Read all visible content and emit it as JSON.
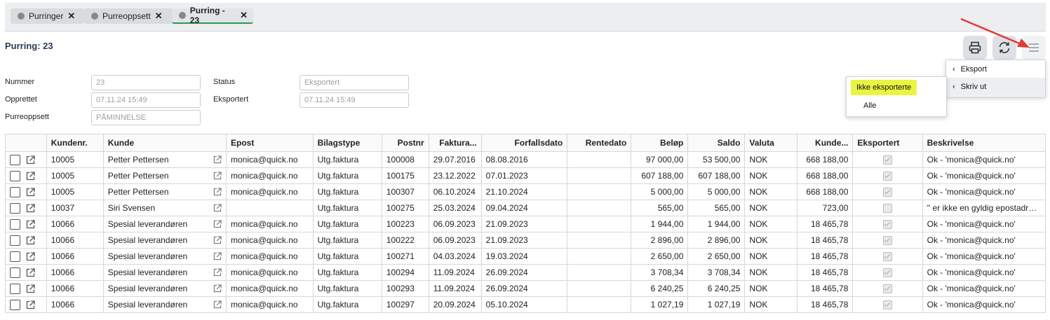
{
  "tabs": [
    {
      "label": "Purringer",
      "active": false
    },
    {
      "label": "Purreoppsett",
      "active": false
    },
    {
      "label": "Purring - 23",
      "active": true
    }
  ],
  "page": {
    "title": "Purring: 23"
  },
  "toolbar": {
    "icons": [
      "printer-icon",
      "refresh-icon",
      "hamburger-menu-icon"
    ]
  },
  "form": {
    "nummer": {
      "label": "Nummer",
      "value": "23"
    },
    "opprettet": {
      "label": "Opprettet",
      "value": "07.11.24 15:49"
    },
    "purreoppsett": {
      "label": "Purreoppsett",
      "value": "PÅMINNELSE"
    },
    "status": {
      "label": "Status",
      "value": "Eksportert"
    },
    "eksportert": {
      "label": "Eksportert",
      "value": "07.11.24 15:49"
    }
  },
  "menu": {
    "main": [
      "Eksport",
      "Skriv ut"
    ],
    "submenu": [
      "Ikke eksporterte",
      "Alle"
    ]
  },
  "colors": {
    "active_tab_underline": "#2e9a46",
    "highlight": "#e9f542",
    "arrow": "#e23b3b"
  },
  "table": {
    "headers": [
      "",
      "Kundenr.",
      "Kunde",
      "Epost",
      "Bilagstype",
      "Postnr",
      "Faktura...",
      "Forfallsdato",
      "Rentedato",
      "Beløp",
      "Saldo",
      "Valuta",
      "Kunde...",
      "Eksportert",
      "Beskrivelse"
    ],
    "rows": [
      {
        "kundenr": "10005",
        "kunde": "Petter Pettersen",
        "epost": "monica@quick.no",
        "bilagstype": "Utg.faktura",
        "postnr": "100008",
        "faktura": "29.07.2016",
        "forfall": "08.08.2016",
        "rente": "",
        "belop": "97 000,00",
        "saldo": "53 500,00",
        "valuta": "NOK",
        "kundesaldo": "668 188,00",
        "eksportert": true,
        "beskrivelse": "Ok - 'monica@quick.no'"
      },
      {
        "kundenr": "10005",
        "kunde": "Petter Pettersen",
        "epost": "monica@quick.no",
        "bilagstype": "Utg.faktura",
        "postnr": "100175",
        "faktura": "23.12.2022",
        "forfall": "07.01.2023",
        "rente": "",
        "belop": "607 188,00",
        "saldo": "607 188,00",
        "valuta": "NOK",
        "kundesaldo": "668 188,00",
        "eksportert": true,
        "beskrivelse": "Ok - 'monica@quick.no'"
      },
      {
        "kundenr": "10005",
        "kunde": "Petter Pettersen",
        "epost": "monica@quick.no",
        "bilagstype": "Utg.faktura",
        "postnr": "100307",
        "faktura": "06.10.2024",
        "forfall": "21.10.2024",
        "rente": "",
        "belop": "5 000,00",
        "saldo": "5 000,00",
        "valuta": "NOK",
        "kundesaldo": "668 188,00",
        "eksportert": true,
        "beskrivelse": "Ok - 'monica@quick.no'"
      },
      {
        "kundenr": "10037",
        "kunde": "Siri Svensen",
        "epost": "",
        "bilagstype": "Utg.faktura",
        "postnr": "100275",
        "faktura": "25.03.2024",
        "forfall": "09.04.2024",
        "rente": "",
        "belop": "565,00",
        "saldo": "565,00",
        "valuta": "NOK",
        "kundesaldo": "723,00",
        "eksportert": false,
        "beskrivelse": "'' er ikke en gyldig epostadresse"
      },
      {
        "kundenr": "10066",
        "kunde": "Spesial leverandøren",
        "epost": "monica@quick.no",
        "bilagstype": "Utg.faktura",
        "postnr": "100223",
        "faktura": "06.09.2023",
        "forfall": "21.09.2023",
        "rente": "",
        "belop": "1 944,00",
        "saldo": "1 944,00",
        "valuta": "NOK",
        "kundesaldo": "18 465,78",
        "eksportert": true,
        "beskrivelse": "Ok - 'monica@quick.no'"
      },
      {
        "kundenr": "10066",
        "kunde": "Spesial leverandøren",
        "epost": "monica@quick.no",
        "bilagstype": "Utg.faktura",
        "postnr": "100222",
        "faktura": "06.09.2023",
        "forfall": "21.09.2023",
        "rente": "",
        "belop": "2 896,00",
        "saldo": "2 896,00",
        "valuta": "NOK",
        "kundesaldo": "18 465,78",
        "eksportert": true,
        "beskrivelse": "Ok - 'monica@quick.no'"
      },
      {
        "kundenr": "10066",
        "kunde": "Spesial leverandøren",
        "epost": "monica@quick.no",
        "bilagstype": "Utg.faktura",
        "postnr": "100271",
        "faktura": "04.03.2024",
        "forfall": "19.03.2024",
        "rente": "",
        "belop": "2 650,00",
        "saldo": "2 650,00",
        "valuta": "NOK",
        "kundesaldo": "18 465,78",
        "eksportert": true,
        "beskrivelse": "Ok - 'monica@quick.no'"
      },
      {
        "kundenr": "10066",
        "kunde": "Spesial leverandøren",
        "epost": "monica@quick.no",
        "bilagstype": "Utg.faktura",
        "postnr": "100294",
        "faktura": "11.09.2024",
        "forfall": "26.09.2024",
        "rente": "",
        "belop": "3 708,34",
        "saldo": "3 708,34",
        "valuta": "NOK",
        "kundesaldo": "18 465,78",
        "eksportert": true,
        "beskrivelse": "Ok - 'monica@quick.no'"
      },
      {
        "kundenr": "10066",
        "kunde": "Spesial leverandøren",
        "epost": "monica@quick.no",
        "bilagstype": "Utg.faktura",
        "postnr": "100293",
        "faktura": "11.09.2024",
        "forfall": "26.09.2024",
        "rente": "",
        "belop": "6 240,25",
        "saldo": "6 240,25",
        "valuta": "NOK",
        "kundesaldo": "18 465,78",
        "eksportert": true,
        "beskrivelse": "Ok - 'monica@quick.no'"
      },
      {
        "kundenr": "10066",
        "kunde": "Spesial leverandøren",
        "epost": "monica@quick.no",
        "bilagstype": "Utg.faktura",
        "postnr": "100297",
        "faktura": "20.09.2024",
        "forfall": "05.10.2024",
        "rente": "",
        "belop": "1 027,19",
        "saldo": "1 027,19",
        "valuta": "NOK",
        "kundesaldo": "18 465,78",
        "eksportert": true,
        "beskrivelse": "Ok - 'monica@quick.no'"
      }
    ]
  }
}
